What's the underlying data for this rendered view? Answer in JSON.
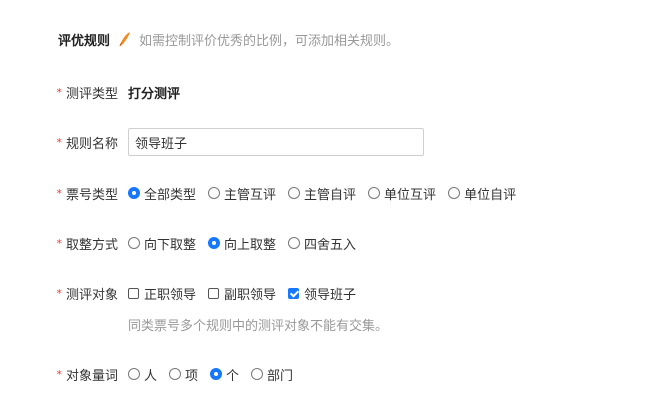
{
  "header": {
    "title": "评优规则",
    "hint": "如需控制评价优秀的比例，可添加相关规则。",
    "icon": "pen-icon"
  },
  "colors": {
    "accent": "#1677ff",
    "required": "#e4393c",
    "hint": "#999999"
  },
  "required_mark": "*",
  "fields": {
    "eval_type": {
      "label": "测评类型",
      "value": "打分测评"
    },
    "rule_name": {
      "label": "规则名称",
      "value": "领导班子",
      "placeholder": ""
    },
    "ticket_type": {
      "label": "票号类型",
      "options": [
        "全部类型",
        "主管互评",
        "主管自评",
        "单位互评",
        "单位自评"
      ],
      "selected": "全部类型"
    },
    "rounding": {
      "label": "取整方式",
      "options": [
        "向下取整",
        "向上取整",
        "四舍五入"
      ],
      "selected": "向上取整"
    },
    "eval_target": {
      "label": "测评对象",
      "options": [
        "正职领导",
        "副职领导",
        "领导班子"
      ],
      "checked": [
        "领导班子"
      ],
      "note": "同类票号多个规则中的测评对象不能有交集。"
    },
    "measure_word": {
      "label": "对象量词",
      "options": [
        "人",
        "项",
        "个",
        "部门"
      ],
      "selected": "个"
    }
  }
}
